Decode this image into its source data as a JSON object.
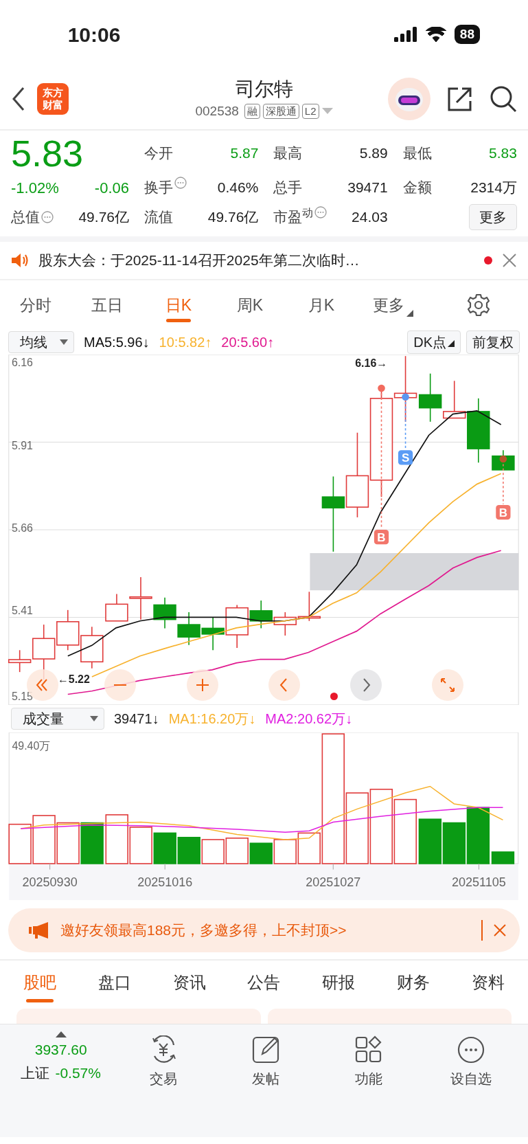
{
  "status_bar": {
    "time": "10:06",
    "battery": "88"
  },
  "header": {
    "logo_lines": [
      "东方",
      "财富"
    ],
    "title": "司尔特",
    "code": "002538",
    "tags": [
      "融",
      "深股通",
      "L2"
    ]
  },
  "quote": {
    "price": "5.83",
    "change_pct": "-1.02%",
    "change": "-0.06",
    "market_cap": {
      "label": "总值",
      "value": "49.76亿"
    },
    "stats": [
      {
        "label": "今开",
        "value": "5.87",
        "color": "#0a9d15",
        "info": false
      },
      {
        "label": "最高",
        "value": "5.89",
        "color": "#222222",
        "info": false
      },
      {
        "label": "最低",
        "value": "5.83",
        "color": "#0a9d15",
        "info": false
      },
      {
        "label": "换手",
        "value": "0.46%",
        "color": "#222222",
        "info": true
      },
      {
        "label": "总手",
        "value": "39471",
        "color": "#222222",
        "info": false
      },
      {
        "label": "金额",
        "value": "2314万",
        "color": "#222222",
        "info": false
      },
      {
        "label": "流值",
        "value": "49.76亿",
        "color": "#222222",
        "info": false
      },
      {
        "label": "市盈$^{动}$",
        "value": "24.03",
        "color": "#222222",
        "info": true
      }
    ],
    "more_button": "更多"
  },
  "notice": {
    "text": "股东大会：于2025-11-14召开2025年第二次临时…",
    "unread": true
  },
  "tabs": [
    {
      "label": "分时",
      "selected": false,
      "caret": false
    },
    {
      "label": "五日",
      "selected": false,
      "caret": false
    },
    {
      "label": "日K",
      "selected": true,
      "caret": false
    },
    {
      "label": "周K",
      "selected": false,
      "caret": false
    },
    {
      "label": "月K",
      "selected": false,
      "caret": false
    },
    {
      "label": "更多",
      "selected": false,
      "caret": true
    }
  ],
  "kline": {
    "indicator": "均线",
    "legend": [
      {
        "text": ":5.96↓"
      },
      {
        "text": ":5.82↑"
      },
      {
        "text": ":5.60↑"
      }
    ],
    "buttons": [
      "DK点",
      "前复权"
    ],
    "max_label": "6.16→",
    "min_label": "←5.22",
    "markers": [
      {
        "kind": "buy",
        "label": "B"
      },
      {
        "kind": "sell",
        "label": "S"
      },
      {
        "kind": "buy",
        "label": "B"
      }
    ],
    "chart_data": {
      "type": "line",
      "ylim": [
        5.125,
        6.185
      ],
      "yticks": [
        6.16,
        5.91,
        5.66,
        5.41,
        5.15
      ],
      "series": [
        {
          "name": "MA5",
          "color": "#111111",
          "values": [
            null,
            null,
            5.273,
            5.305,
            5.358,
            5.379,
            5.39,
            5.39,
            5.39,
            5.39,
            5.379,
            5.379,
            5.39,
            5.464,
            5.549,
            5.708,
            null,
            5.941,
            6.005,
            6.015,
            5.973
          ]
        },
        {
          "name": "10",
          "color": "#f7b22e",
          "values": [
            null,
            null,
            null,
            5.21,
            null,
            5.273,
            5.295,
            5.316,
            5.337,
            5.358,
            5.369,
            5.379,
            5.39,
            5.432,
            5.464,
            5.528,
            5.602,
            5.676,
            5.74,
            5.793,
            5.825
          ]
        },
        {
          "name": "20",
          "color": "#e0198f",
          "values": [
            null,
            null,
            5.157,
            5.167,
            null,
            5.199,
            5.21,
            5.221,
            5.231,
            5.252,
            5.263,
            5.263,
            5.284,
            5.316,
            5.348,
            5.401,
            5.444,
            5.486,
            5.539,
            5.571,
            5.592
          ]
        }
      ]
    }
  },
  "volume": {
    "indicator": "成交量",
    "legend": [
      {
        "text": "39471↓",
        "color": "#222222"
      },
      {
        "text": "MA1:16.20万↓",
        "color": "#f7b22e"
      },
      {
        "text": "MA2:20.62万↓",
        "color": "#e020e0"
      }
    ],
    "y_label": "49.40万",
    "dates": [
      "20250930",
      "20251016",
      "20251027",
      "20251105"
    ]
  },
  "banner": {
    "text": "邀好友领最高188元，多邀多得，上不封顶>>"
  },
  "section_tabs": [
    {
      "label": "股吧",
      "selected": true
    },
    {
      "label": "盘口",
      "selected": false
    },
    {
      "label": "资讯",
      "selected": false
    },
    {
      "label": "公告",
      "selected": false
    },
    {
      "label": "研报",
      "selected": false
    },
    {
      "label": "财务",
      "selected": false
    },
    {
      "label": "资料",
      "selected": false
    }
  ],
  "bottom_nav": {
    "index": {
      "value": "3937.60",
      "name": "上证",
      "change": "-0.57%"
    },
    "items": [
      {
        "label": "交易"
      },
      {
        "label": "发帖"
      },
      {
        "label": "功能"
      },
      {
        "label": "设自选"
      }
    ]
  }
}
